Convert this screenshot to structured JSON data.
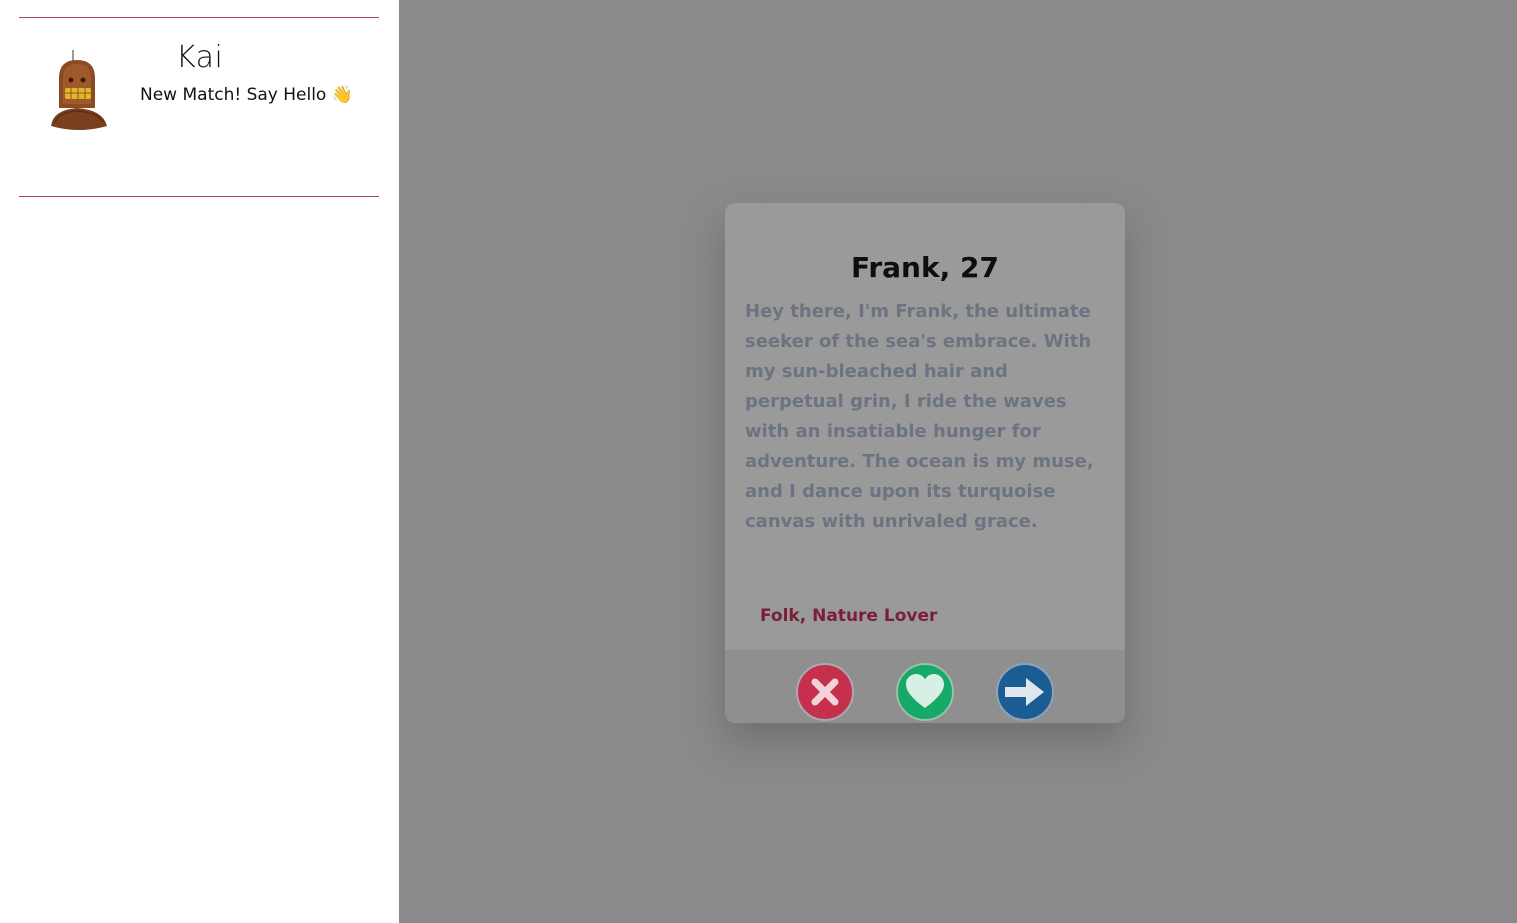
{
  "sidebar": {
    "matches": [
      {
        "name": "Kai",
        "message": "New Match! Say Hello 👋",
        "avatar_icon": "robot-avatar-icon"
      }
    ]
  },
  "profile_card": {
    "name_age": "Frank, 27",
    "bio": "Hey there, I'm Frank, the ultimate seeker of the sea's embrace. With my sun-bleached hair and perpetual grin, I ride the waves with an insatiable hunger for adventure. The ocean is my muse, and I dance upon its turquoise canvas with unrivaled grace.",
    "tags": "Folk, Nature Lover",
    "actions": {
      "reject_icon": "close-icon",
      "like_icon": "heart-icon",
      "next_icon": "arrow-right-icon"
    }
  },
  "colors": {
    "accent": "#a6475f",
    "overlay": "#8a8a8c",
    "reject": "#c5304d",
    "like": "#17a968",
    "next": "#1b5c94",
    "tags": "#7b1e38"
  }
}
